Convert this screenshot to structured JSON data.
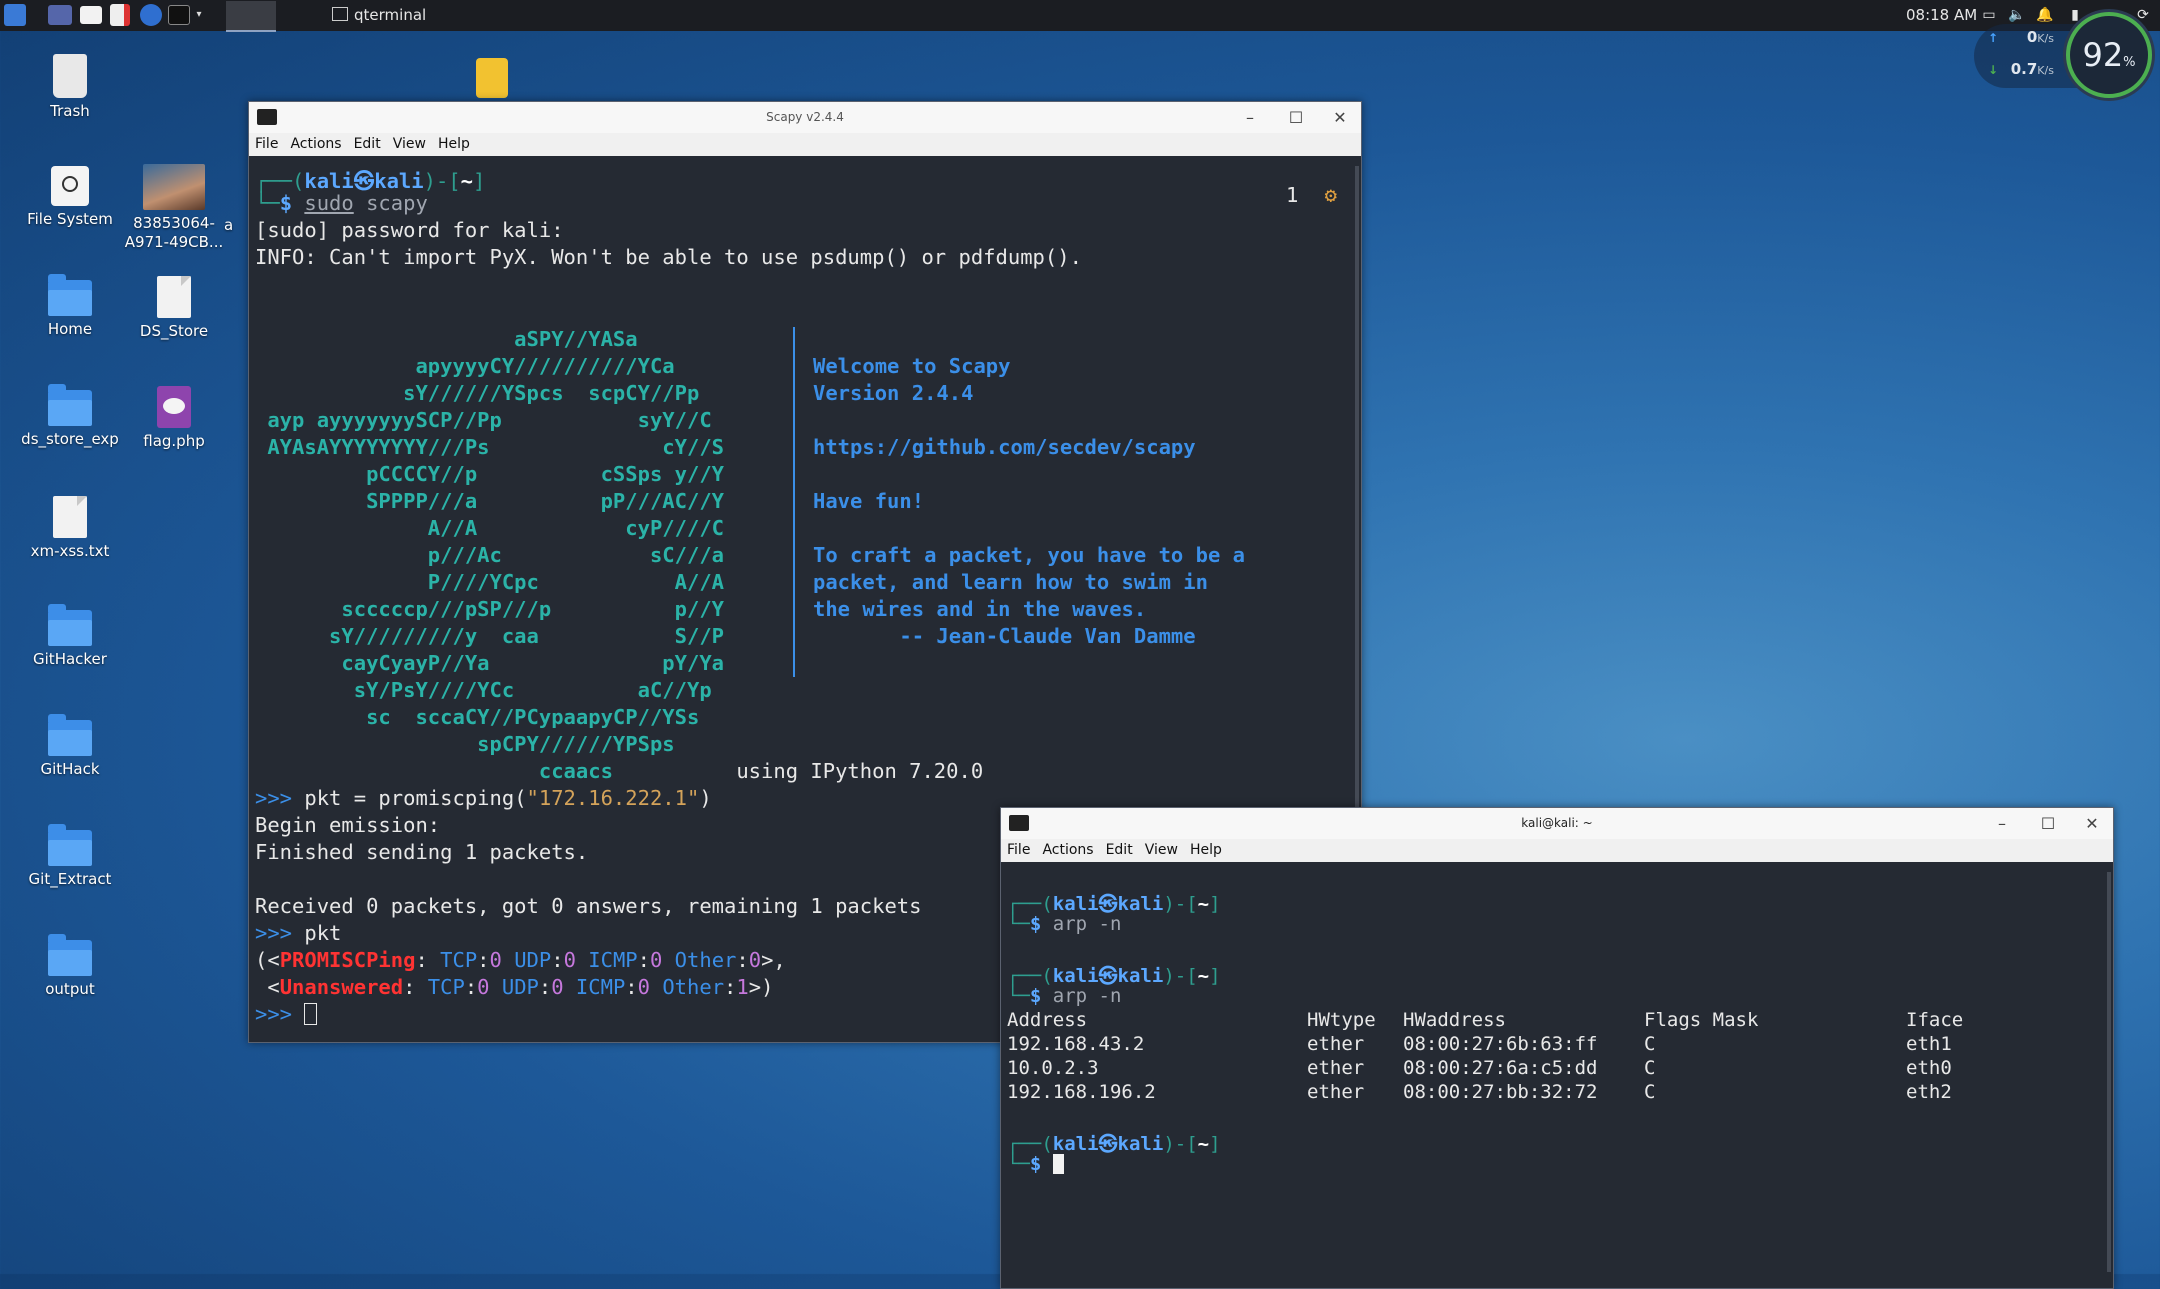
{
  "taskbar": {
    "task_label": "qterminal",
    "clock": "08:18 AM"
  },
  "netwidget": {
    "up_value": "0",
    "up_unit": "K/s",
    "down_value": "0.7",
    "down_unit": "K/s",
    "gauge_value": "92",
    "gauge_unit": "%"
  },
  "desktop": {
    "icons": [
      {
        "label": "Trash",
        "icon": "trash-icon"
      },
      {
        "label": "File System",
        "icon": "drive-icon"
      },
      {
        "label": "83853064-A971-49CB...",
        "icon": "image-thumbnail"
      },
      {
        "label": "Home",
        "icon": "home-folder-icon"
      },
      {
        "label": "DS_Store",
        "icon": "binary-file-icon"
      },
      {
        "label": "ds_store_exp",
        "icon": "folder-icon"
      },
      {
        "label": "flag.php",
        "icon": "php-file-icon"
      },
      {
        "label": "xm-xss.txt",
        "icon": "text-file-icon"
      },
      {
        "label": "GitHacker",
        "icon": "folder-icon"
      },
      {
        "label": "GitHack",
        "icon": "folder-icon"
      },
      {
        "label": "Git_Extract",
        "icon": "folder-icon"
      },
      {
        "label": "output",
        "icon": "folder-icon"
      }
    ],
    "partial_label": "a"
  },
  "scapy_window": {
    "title": "Scapy v2.4.4",
    "menu": [
      "File",
      "Actions",
      "Edit",
      "View",
      "Help"
    ],
    "badge_count": "1",
    "prompt_user": "kali",
    "prompt_host": "kali",
    "prompt_dir": "~",
    "cmd_sudo": "sudo",
    "cmd_rest": " scapy",
    "sudo_line": "[sudo] password for kali:",
    "info_line": "INFO: Can't import PyX. Won't be able to use psdump() or pdfdump().",
    "art": [
      "                     aSPY//YASa",
      "             apyyyyCY//////////YCa",
      "            sY//////YSpcs  scpCY//Pp",
      " ayp ayyyyyyySCP//Pp           syY//C",
      " AYAsAYYYYYYYY///Ps              cY//S",
      "         pCCCCY//p          cSSps y//Y",
      "         SPPPP///a          pP///AC//Y",
      "              A//A            cyP////C",
      "              p///Ac            sC///a",
      "              P////YCpc           A//A",
      "       scccccp///pSP///p          p//Y",
      "      sY/////////y  caa           S//P",
      "       cayCyayP//Ya              pY/Ya",
      "        sY/PsY////YCc          aC//Yp",
      "         sc  sccaCY//PCypaapyCP//YSs",
      "                  spCPY//////YPSps",
      "                       ccaacs"
    ],
    "welcome": [
      "Welcome to Scapy",
      "Version 2.4.4",
      "",
      "https://github.com/secdev/scapy",
      "",
      "Have fun!",
      "",
      "To craft a packet, you have to be a",
      "packet, and learn how to swim in",
      "the wires and in the waves.",
      "       -- Jean-Claude Van Damme"
    ],
    "ipython_line": "                                       using IPython 7.20.0",
    "ps1": ">>>",
    "cmd1_prefix": " pkt = promiscping(",
    "cmd1_arg": "\"172.16.222.1\"",
    "cmd1_suffix": ")",
    "out_begin": "Begin emission:",
    "out_finished": "Finished sending 1 packets.",
    "out_received": "Received 0 packets, got 0 answers, remaining 1 packets",
    "cmd2": " pkt",
    "res1_open": "(<",
    "res1_name": "PROMISCPing",
    "res2_open": " <",
    "res2_name": "Unanswered",
    "tcp_label": "TCP",
    "udp_label": "UDP",
    "icmp_label": "ICMP",
    "other_label": "Other",
    "res1_tcp": "0",
    "res1_udp": "0",
    "res1_icmp": "0",
    "res1_other": "0",
    "res1_close": ">,",
    "res2_tcp": "0",
    "res2_udp": "0",
    "res2_icmp": "0",
    "res2_other": "1",
    "res2_close": ">)"
  },
  "arp_window": {
    "title": "kali@kali: ~",
    "menu": [
      "File",
      "Actions",
      "Edit",
      "View",
      "Help"
    ],
    "prompt_user": "kali",
    "prompt_host": "kali",
    "prompt_dir": "~",
    "cmd": "arp -n",
    "table_header": [
      "Address",
      "HWtype",
      "HWaddress",
      "Flags Mask",
      "Iface"
    ],
    "rows": [
      [
        "192.168.43.2",
        "ether",
        "08:00:27:6b:63:ff",
        "C",
        "eth1"
      ],
      [
        "10.0.2.3",
        "ether",
        "08:00:27:6a:c5:dd",
        "C",
        "eth0"
      ],
      [
        "192.168.196.2",
        "ether",
        "08:00:27:bb:32:72",
        "C",
        "eth2"
      ]
    ]
  },
  "colors": {
    "terminal_bg": "#252a33",
    "prompt_blue": "#5ca8ff",
    "teal": "#2aa198",
    "accent_red": "#ff3333"
  }
}
